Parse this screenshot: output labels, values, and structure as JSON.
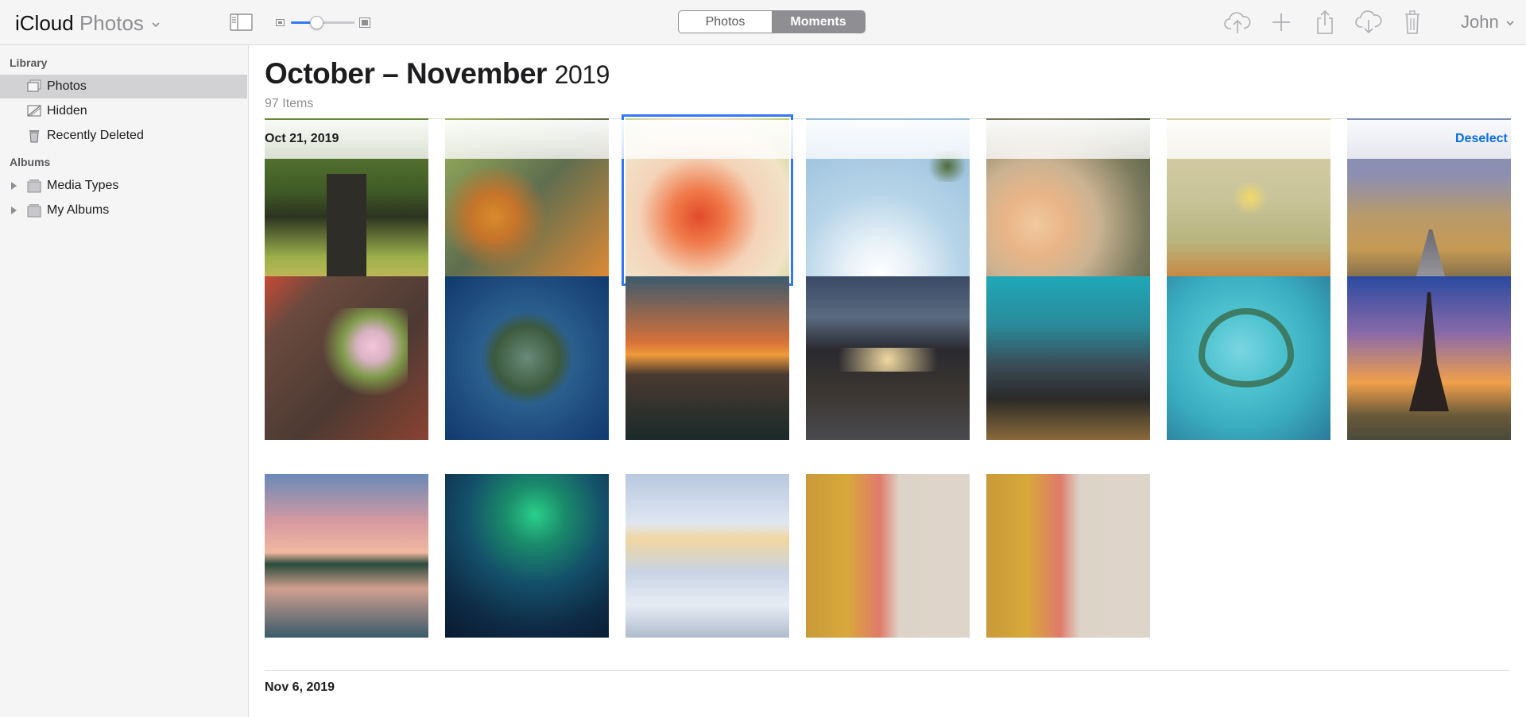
{
  "window": {
    "brand_main": "iCloud",
    "brand_app": "Photos"
  },
  "toolbar": {
    "zoom_level": 0.4,
    "tabs": [
      {
        "label": "Photos",
        "active": false
      },
      {
        "label": "Moments",
        "active": true
      }
    ],
    "actions": [
      "upload-icon",
      "add-icon",
      "share-icon",
      "download-icon",
      "trash-icon"
    ],
    "user": "John"
  },
  "sidebar": {
    "library_header": "Library",
    "library_items": [
      {
        "label": "Photos",
        "icon": "photos-icon",
        "selected": true
      },
      {
        "label": "Hidden",
        "icon": "hidden-icon",
        "selected": false
      },
      {
        "label": "Recently Deleted",
        "icon": "trash-icon",
        "selected": false
      }
    ],
    "albums_header": "Albums",
    "album_items": [
      {
        "label": "Media Types",
        "icon": "album-stack-icon"
      },
      {
        "label": "My Albums",
        "icon": "album-stack-icon"
      }
    ]
  },
  "main": {
    "title_range": "October – November",
    "title_year": "2019",
    "count": "97 Items",
    "sections": [
      {
        "date": "Oct 21, 2019",
        "action": "Deselect"
      },
      {
        "date": "Nov 6, 2019"
      }
    ]
  },
  "colors": {
    "accent": "#3478f6",
    "link": "#0a6ee0",
    "sidebar_bg": "#f5f5f5",
    "selected_row": "#d2d2d4"
  }
}
